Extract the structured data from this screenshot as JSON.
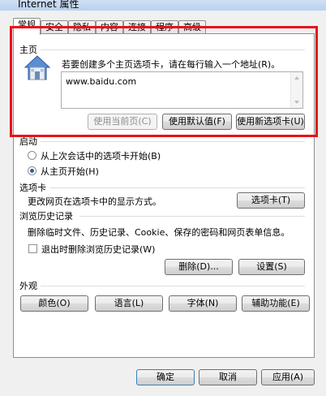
{
  "window": {
    "title": "Internet 属性"
  },
  "tabs": [
    {
      "label": "常规",
      "active": true
    },
    {
      "label": "安全",
      "active": false
    },
    {
      "label": "隐私",
      "active": false
    },
    {
      "label": "内容",
      "active": false
    },
    {
      "label": "连接",
      "active": false
    },
    {
      "label": "程序",
      "active": false
    },
    {
      "label": "高级",
      "active": false
    }
  ],
  "homepage": {
    "section_title": "主页",
    "instruction": "若要创建多个主页选项卡，请在每行输入一个地址(R)。",
    "url_value": "www.baidu.com",
    "btn_current": "使用当前页(C)",
    "btn_default": "使用默认值(F)",
    "btn_new_tab": "使用新选项卡(U)"
  },
  "startup": {
    "section_title": "启动",
    "option_last_session": "从上次会话中的选项卡开始(B)",
    "option_homepage": "从主页开始(H)",
    "selected": "homepage"
  },
  "tabs_section": {
    "section_title": "选项卡",
    "description": "更改网页在选项卡中的显示方式。",
    "btn_tabs": "选项卡(T)"
  },
  "history": {
    "section_title": "浏览历史记录",
    "description": "删除临时文件、历史记录、Cookie、保存的密码和网页表单信息。",
    "checkbox_label": "退出时删除浏览历史记录(W)",
    "checkbox_checked": false,
    "btn_delete": "删除(D)...",
    "btn_settings": "设置(S)"
  },
  "appearance": {
    "section_title": "外观",
    "btn_colors": "颜色(O)",
    "btn_languages": "语言(L)",
    "btn_fonts": "字体(N)",
    "btn_accessibility": "辅助功能(E)"
  },
  "footer": {
    "btn_ok": "确定",
    "btn_cancel": "取消",
    "btn_apply": "应用(A)"
  },
  "colors": {
    "highlight_border": "#e8101b",
    "section_line": "#d5dfe5"
  }
}
